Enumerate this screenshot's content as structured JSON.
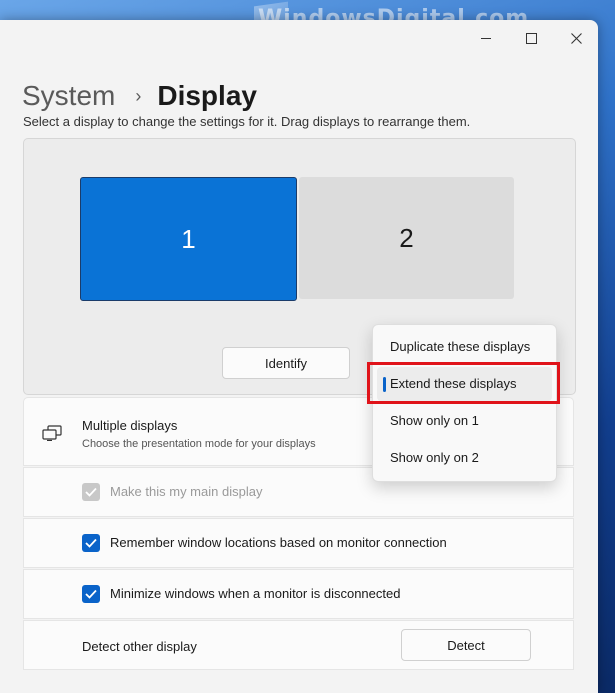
{
  "watermark": "WindowsDigital.com",
  "breadcrumb": {
    "parent": "System",
    "separator": "›",
    "current": "Display"
  },
  "description": "Select a display to change the settings for it. Drag displays to rearrange them.",
  "monitors": [
    {
      "label": "1",
      "selected": true
    },
    {
      "label": "2",
      "selected": false
    }
  ],
  "identify_label": "Identify",
  "multiple_displays": {
    "title": "Multiple displays",
    "subtitle": "Choose the presentation mode for your displays",
    "icon": "multiple-displays-icon"
  },
  "dropdown": {
    "options": [
      "Duplicate these displays",
      "Extend these displays",
      "Show only on 1",
      "Show only on 2"
    ],
    "selected": "Extend these displays"
  },
  "checkboxes": {
    "main_display": {
      "label": "Make this my main display",
      "checked": true,
      "enabled": false
    },
    "remember_locations": {
      "label": "Remember window locations based on monitor connection",
      "checked": true,
      "enabled": true
    },
    "minimize_windows": {
      "label": "Minimize windows when a monitor is disconnected",
      "checked": true,
      "enabled": true
    }
  },
  "detect": {
    "label": "Detect other display",
    "button": "Detect"
  },
  "colors": {
    "accent": "#0a73d6",
    "highlight": "#e0131a"
  }
}
